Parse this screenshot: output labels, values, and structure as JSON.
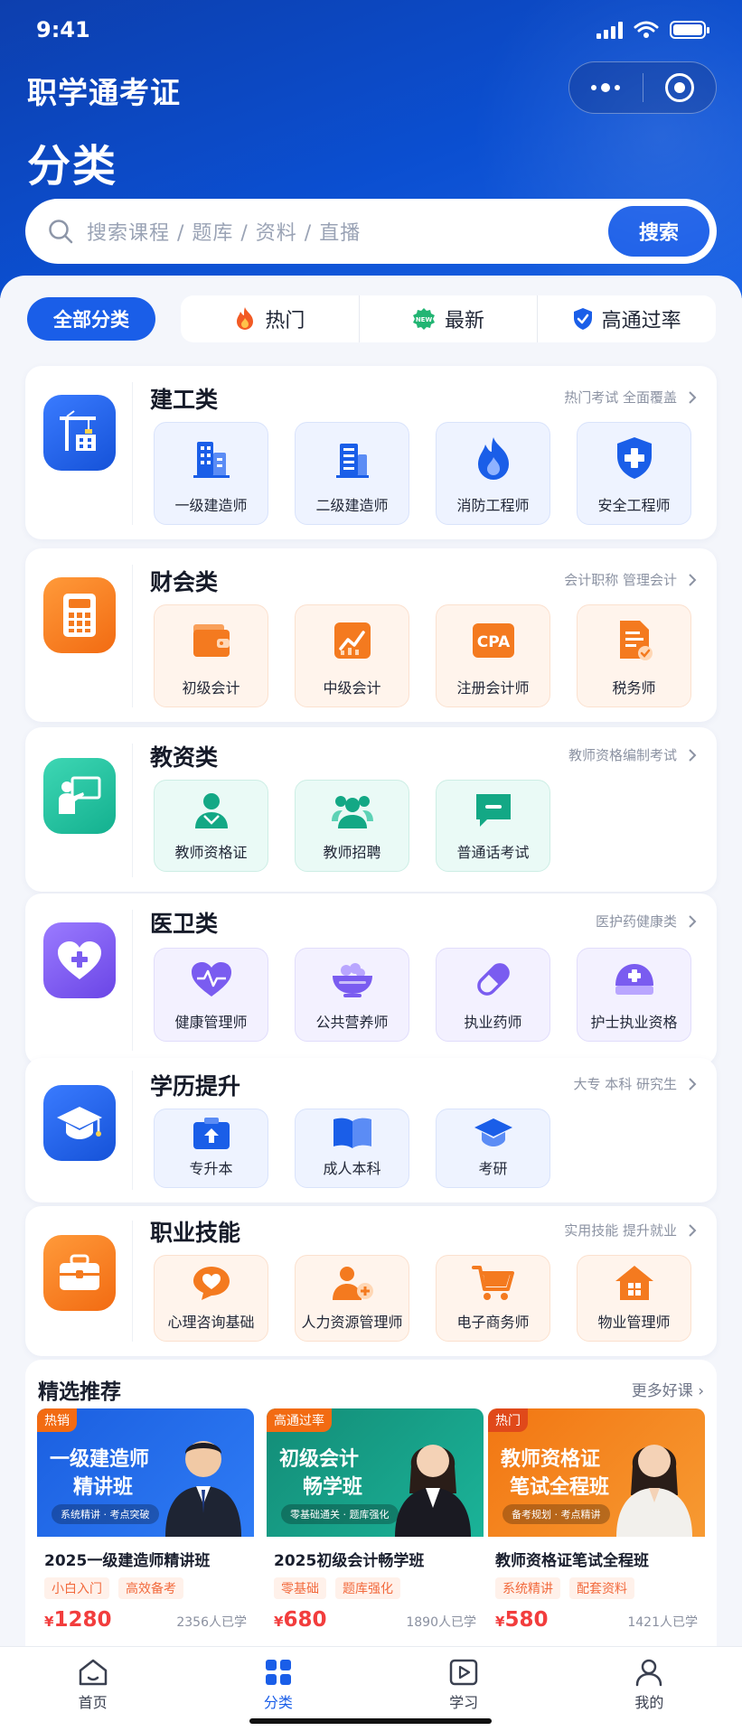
{
  "status_bar": {
    "time": "9:41"
  },
  "header": {
    "app_title": "职学通考证",
    "page_title": "分类"
  },
  "search": {
    "placeholder": "搜索课程 / 题库 / 资料 / 直播",
    "button": "搜索"
  },
  "filters": {
    "all": "全部分类",
    "chips": [
      {
        "label": "热门",
        "icon": "fire-icon"
      },
      {
        "label": "最新",
        "icon": "new-badge-icon",
        "badge": "NEW"
      },
      {
        "label": "高通过率",
        "icon": "shield-check-icon"
      }
    ]
  },
  "categories": [
    {
      "title": "建工类",
      "subtitle": "热门考试 全面覆盖",
      "icon": "construction-crane-icon",
      "color": "#1a5ee8",
      "items": [
        "一级建造师",
        "二级建造师",
        "消防工程师",
        "安全工程师"
      ]
    },
    {
      "title": "财会类",
      "subtitle": "会计职称 管理会计",
      "icon": "calculator-icon",
      "color": "#f47a1f",
      "items": [
        "初级会计",
        "中级会计",
        "注册会计师",
        "税务师"
      ],
      "cpa_text": "CPA"
    },
    {
      "title": "教资类",
      "subtitle": "教师资格编制考试",
      "icon": "teacher-board-icon",
      "color": "#1fbf9b",
      "items": [
        "教师资格证",
        "教师招聘",
        "普通话考试"
      ]
    },
    {
      "title": "医卫类",
      "subtitle": "医护药健康类",
      "icon": "heart-plus-icon",
      "color": "#7a5cf0",
      "items": [
        "健康管理师",
        "公共营养师",
        "执业药师",
        "护士执业资格"
      ]
    },
    {
      "title": "学历提升",
      "subtitle": "大专 本科 研究生",
      "icon": "graduation-cap-icon",
      "color": "#1a5ee8",
      "items": [
        "专升本",
        "成人本科",
        "考研"
      ]
    },
    {
      "title": "职业技能",
      "subtitle": "实用技能 提升就业",
      "icon": "briefcase-icon",
      "color": "#f47a1f",
      "items": [
        "心理咨询基础",
        "人力资源管理师",
        "电子商务师",
        "物业管理师"
      ]
    }
  ],
  "recommend": {
    "title": "精选推荐",
    "more": "更多好课",
    "courses": [
      {
        "tag": "热销",
        "banner_title_1": "一级建造师",
        "banner_title_2": "精讲班",
        "banner_pill": "系统精讲 · 考点突破",
        "name": "2025一级建造师精讲班",
        "tags": [
          "小白入门",
          "高效备考"
        ],
        "price_symbol": "¥",
        "price": "1280",
        "learners": "2356人已学"
      },
      {
        "tag": "高通过率",
        "banner_title_1": "初级会计",
        "banner_title_2": "畅学班",
        "banner_pill": "零基础通关 · 题库强化",
        "name": "2025初级会计畅学班",
        "tags": [
          "零基础",
          "题库强化"
        ],
        "price_symbol": "¥",
        "price": "680",
        "learners": "1890人已学"
      },
      {
        "tag": "热门",
        "banner_title_1": "教师资格证",
        "banner_title_2": "笔试全程班",
        "banner_pill": "备考规划 · 考点精讲",
        "name": "教师资格证笔试全程班",
        "tags": [
          "系统精讲",
          "配套资料"
        ],
        "price_symbol": "¥",
        "price": "580",
        "learners": "1421人已学"
      }
    ]
  },
  "tabbar": [
    {
      "label": "首页",
      "icon": "home-icon"
    },
    {
      "label": "分类",
      "icon": "grid-icon",
      "active": true
    },
    {
      "label": "学习",
      "icon": "play-square-icon"
    },
    {
      "label": "我的",
      "icon": "user-icon"
    }
  ]
}
